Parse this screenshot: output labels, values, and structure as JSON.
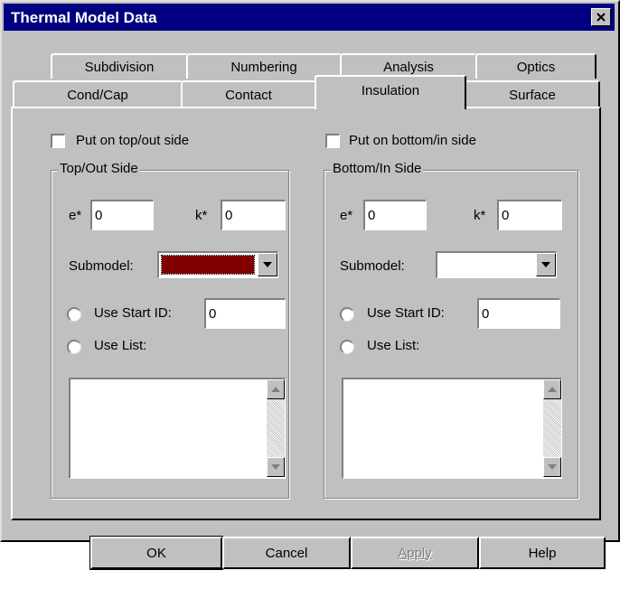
{
  "window": {
    "title": "Thermal Model Data",
    "close_icon": "close-icon"
  },
  "tabs": {
    "row1": [
      {
        "label": "Subdivision"
      },
      {
        "label": "Numbering"
      },
      {
        "label": "Analysis"
      },
      {
        "label": "Optics"
      }
    ],
    "row2": [
      {
        "label": "Cond/Cap"
      },
      {
        "label": "Contact"
      },
      {
        "label": "Insulation",
        "active": true
      },
      {
        "label": "Surface"
      }
    ]
  },
  "top_side": {
    "checkbox_label": "Put on top/out side",
    "checked": false,
    "group_title": "Top/Out Side",
    "e_label": "e*",
    "e_value": "0",
    "k_label": "k*",
    "k_value": "0",
    "submodel_label": "Submodel:",
    "submodel_value": "",
    "submodel_color": "#800000",
    "use_start_id_label": "Use Start ID:",
    "start_id_value": "0",
    "use_list_label": "Use List:"
  },
  "bottom_side": {
    "checkbox_label": "Put on bottom/in side",
    "checked": false,
    "group_title": "Bottom/In Side",
    "e_label": "e*",
    "e_value": "0",
    "k_label": "k*",
    "k_value": "0",
    "submodel_label": "Submodel:",
    "submodel_value": "",
    "use_start_id_label": "Use Start ID:",
    "start_id_value": "0",
    "use_list_label": "Use List:"
  },
  "buttons": {
    "ok": "OK",
    "cancel": "Cancel",
    "apply": "Apply",
    "help": "Help"
  },
  "colors": {
    "titlebar": "#000080",
    "face": "#c0c0c0",
    "submodel_swatch": "#800000"
  }
}
